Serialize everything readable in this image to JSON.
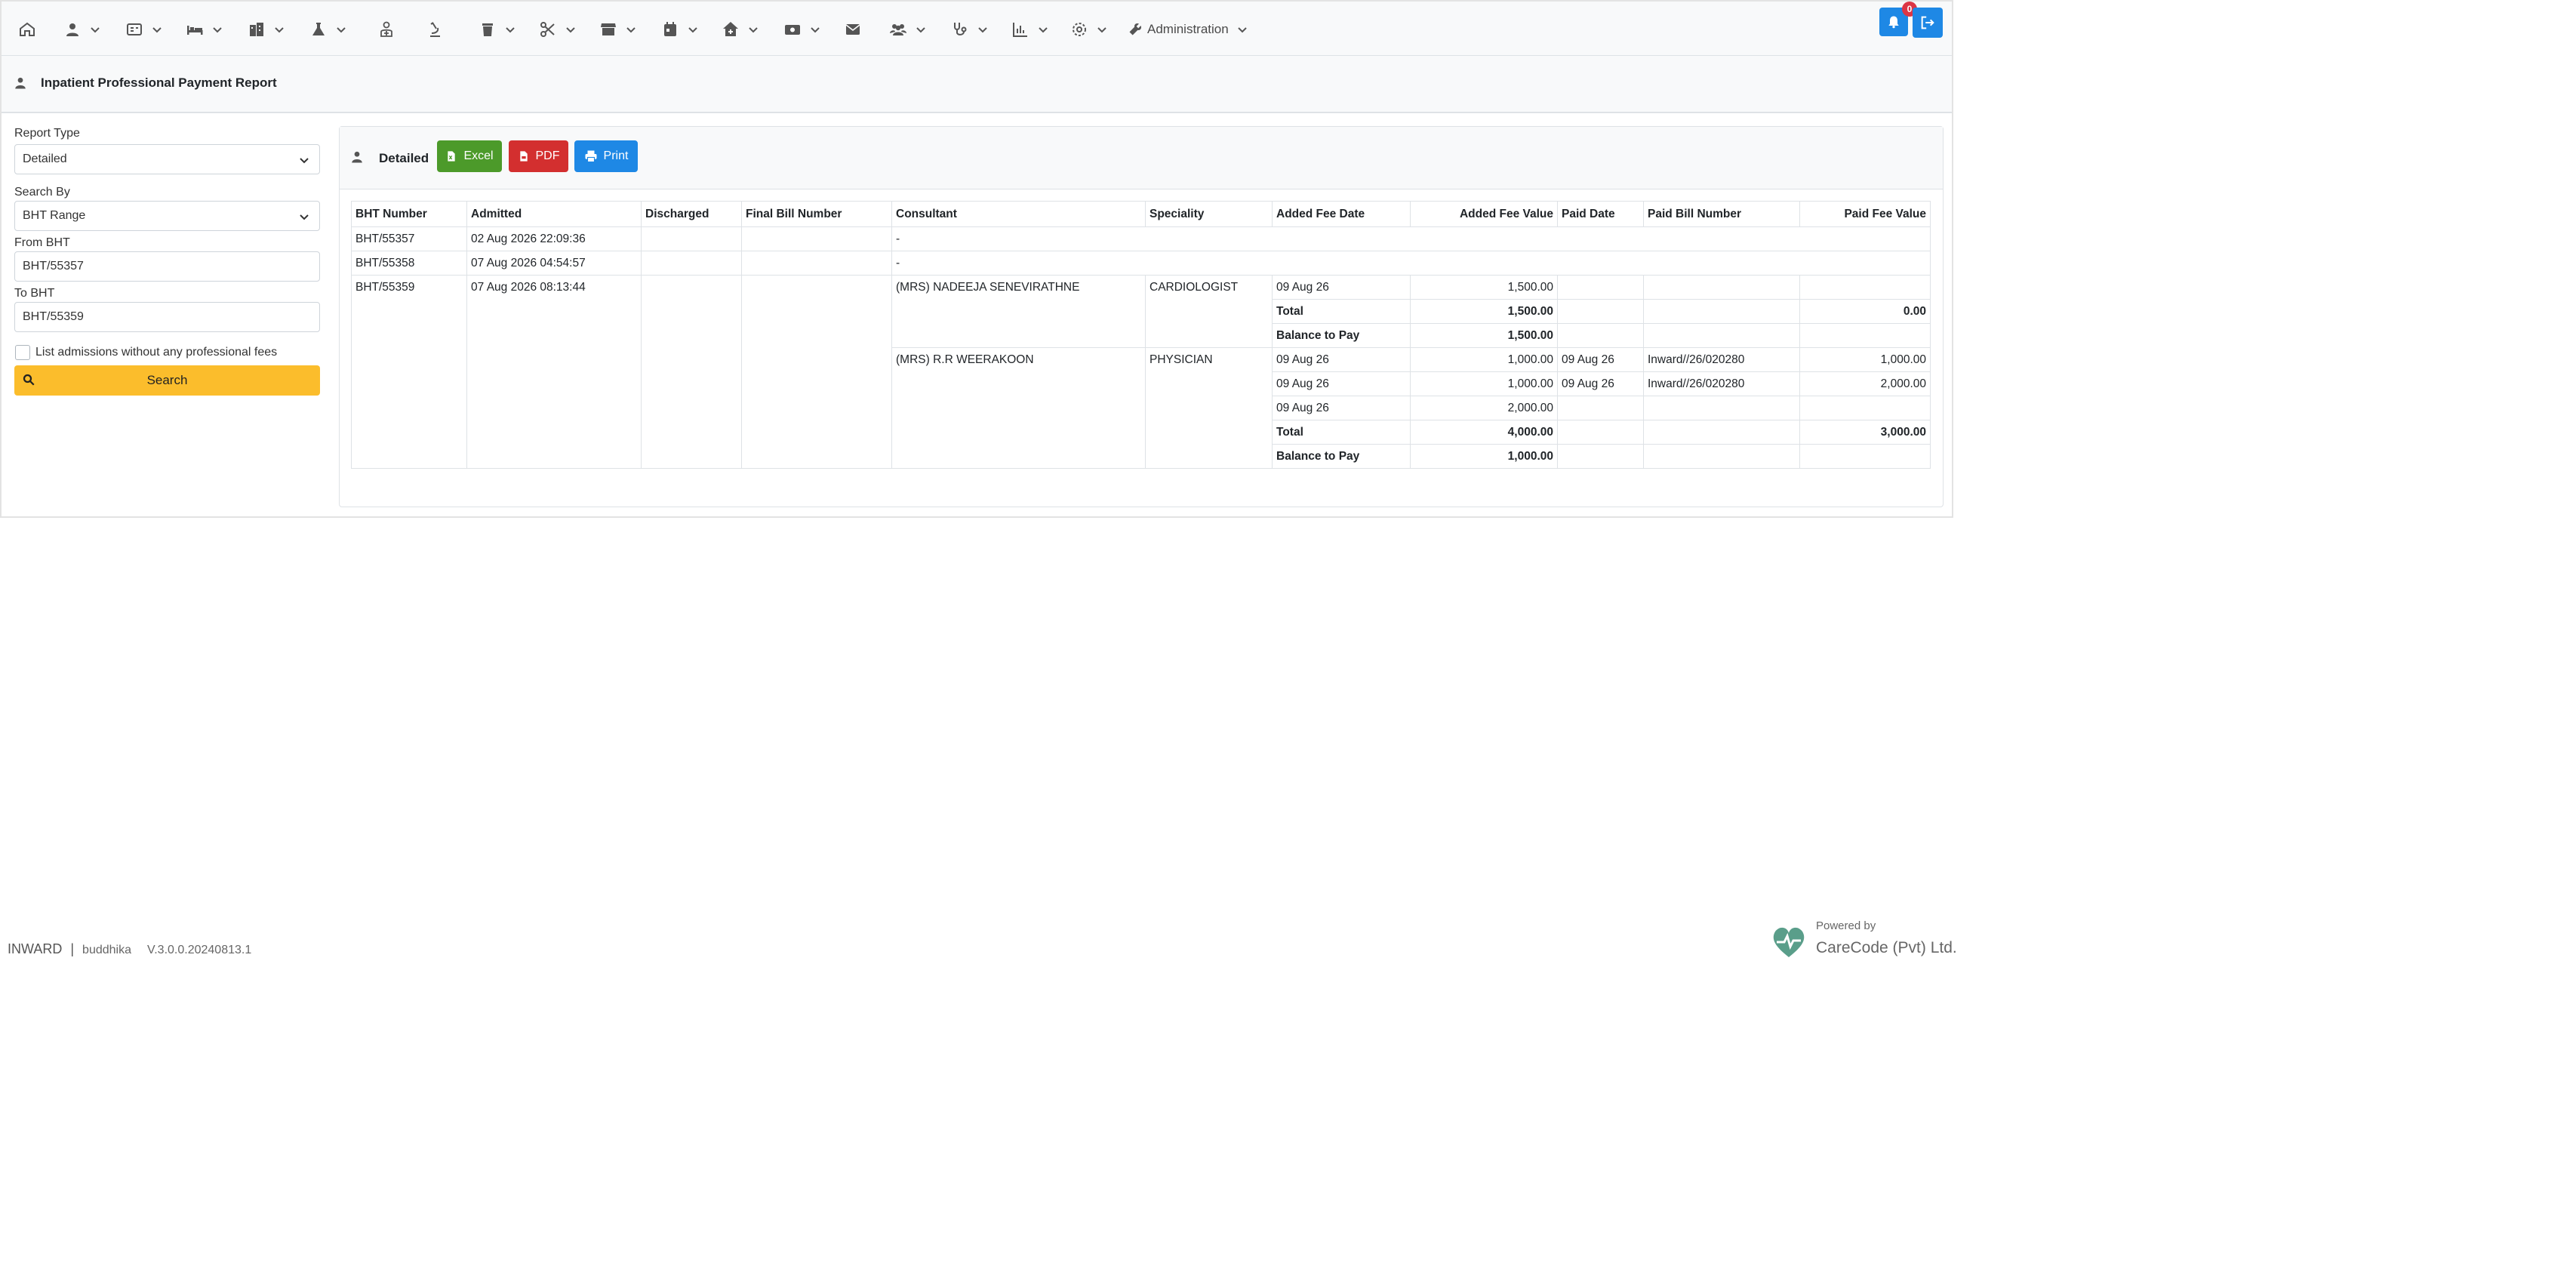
{
  "navbar": {
    "admin_label": "Administration",
    "notification_count": "0",
    "icons": [
      "home-icon",
      "user-icon",
      "id-card-icon",
      "bed-icon",
      "building-icon",
      "flask-icon",
      "doctor-icon",
      "microscope-icon",
      "trash-icon",
      "scissors-icon",
      "store-icon",
      "calendar-icon",
      "house-medical-icon",
      "money-icon",
      "envelope-icon",
      "users-icon",
      "stethoscope-icon",
      "chart-icon",
      "gear-icon",
      "wrench-icon"
    ]
  },
  "page": {
    "title": "Inpatient Professional Payment Report"
  },
  "form": {
    "report_type_label": "Report Type",
    "report_type_value": "Detailed",
    "search_by_label": "Search By",
    "search_by_value": "BHT Range",
    "from_bht_label": "From BHT",
    "from_bht_value": "BHT/55357",
    "to_bht_label": "To BHT",
    "to_bht_value": "BHT/55359",
    "checkbox_label": "List admissions without any professional fees",
    "search_label": "Search"
  },
  "panel": {
    "heading": "Detailed",
    "excel_label": "Excel",
    "pdf_label": "PDF",
    "print_label": "Print"
  },
  "table": {
    "headers": [
      "BHT Number",
      "Admitted",
      "Discharged",
      "Final Bill Number",
      "Consultant",
      "Speciality",
      "Added Fee Date",
      "Added Fee Value",
      "Paid Date",
      "Paid Bill Number",
      "Paid Fee Value"
    ],
    "rows": [
      {
        "bht": "BHT/55357",
        "admitted": "02 Aug 2026 22:09:36",
        "consultant": "-"
      },
      {
        "bht": "BHT/55358",
        "admitted": "07 Aug 2026 04:54:57",
        "consultant": "-"
      },
      {
        "bht": "BHT/55359",
        "admitted": "07 Aug 2026 08:13:44",
        "groups": [
          {
            "consultant": "(MRS) NADEEJA SENEVIRATHNE",
            "speciality": "CARDIOLOGIST",
            "fees": [
              {
                "date": "09 Aug 26",
                "value": "1,500.00",
                "paid_date": "",
                "paid_bill": "",
                "paid_value": ""
              }
            ],
            "total_label": "Total",
            "total_value": "1,500.00",
            "total_paid": "0.00",
            "balance_label": "Balance to Pay",
            "balance_value": "1,500.00"
          },
          {
            "consultant": "(MRS) R.R WEERAKOON",
            "speciality": "PHYSICIAN",
            "fees": [
              {
                "date": "09 Aug 26",
                "value": "1,000.00",
                "paid_date": "09 Aug 26",
                "paid_bill": "Inward//26/020280",
                "paid_value": "1,000.00"
              },
              {
                "date": "09 Aug 26",
                "value": "1,000.00",
                "paid_date": "09 Aug 26",
                "paid_bill": "Inward//26/020280",
                "paid_value": "2,000.00"
              },
              {
                "date": "09 Aug 26",
                "value": "2,000.00",
                "paid_date": "",
                "paid_bill": "",
                "paid_value": ""
              }
            ],
            "total_label": "Total",
            "total_value": "4,000.00",
            "total_paid": "3,000.00",
            "balance_label": "Balance to Pay",
            "balance_value": "1,000.00"
          }
        ]
      }
    ]
  },
  "footer": {
    "module": "INWARD",
    "separator": "|",
    "user": "buddhika",
    "version": "V.3.0.0.20240813.1",
    "powered_by": "Powered by",
    "company": "CareCode (Pvt) Ltd."
  },
  "colors": {
    "primary": "#1e88e5",
    "success": "#4c9a2a",
    "danger": "#d32f2f",
    "warning": "#fbbd2c"
  }
}
